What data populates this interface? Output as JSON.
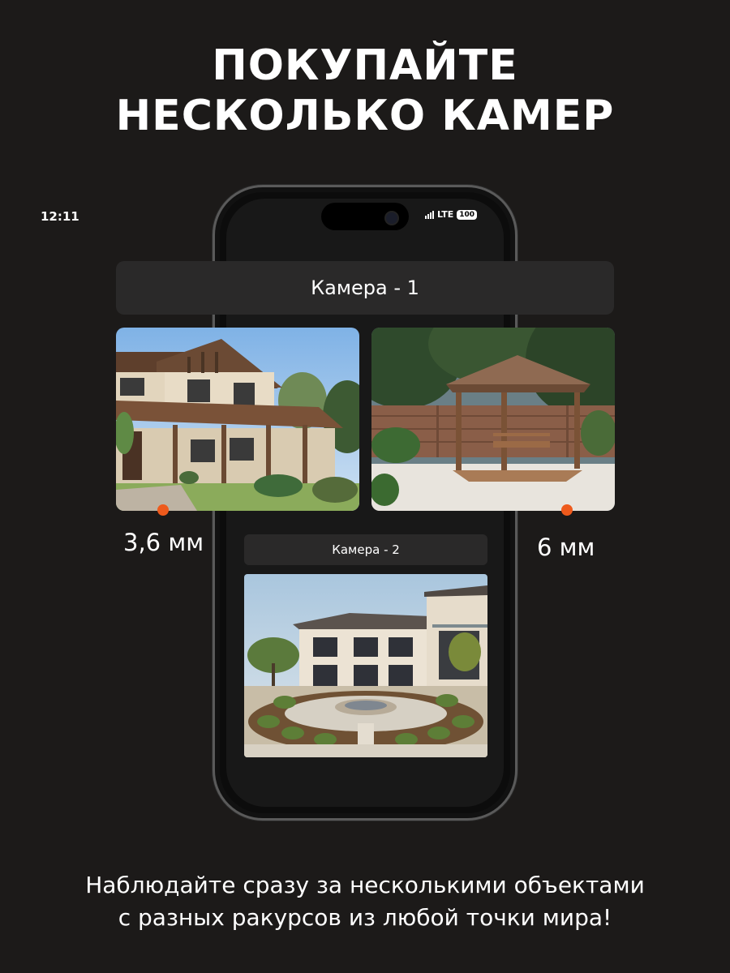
{
  "headline": {
    "line1": "ПОКУПАЙТЕ",
    "line2": "НЕСКОЛЬКО КАМЕР"
  },
  "status_bar": {
    "time": "12:11",
    "network": "LTE",
    "battery": "100"
  },
  "camera1": {
    "label": "Камера - 1"
  },
  "camera2": {
    "label": "Камера - 2"
  },
  "lens": {
    "left": "3,6 мм",
    "right": "6 мм"
  },
  "caption": {
    "line1": "Наблюдайте сразу за несколькими объектами",
    "line2": "с разных ракурсов из любой точки мира!"
  },
  "colors": {
    "background": "#1c1a19",
    "accent": "#ee5a1c",
    "panel": "#2a2929"
  }
}
